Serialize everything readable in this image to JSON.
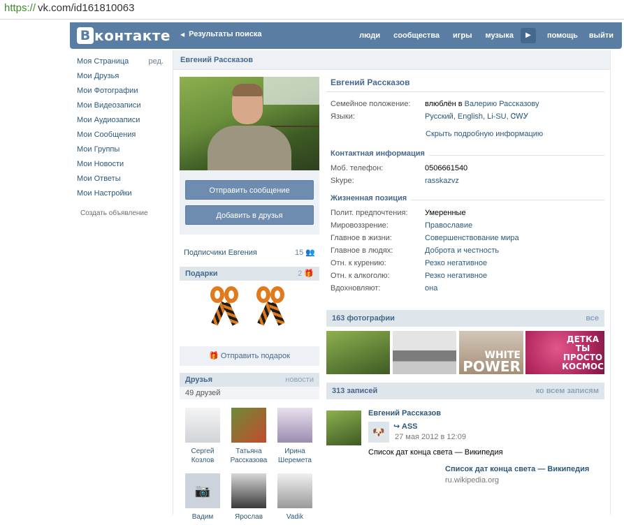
{
  "browser": {
    "url_scheme": "https://",
    "url_rest": "vk.com/id161810063"
  },
  "header": {
    "logo_letter": "В",
    "logo_text": "контакте",
    "back_link": "Результаты поиска",
    "nav": [
      "люди",
      "сообщества",
      "игры",
      "музыка"
    ],
    "nav_after": [
      "помощь",
      "выйти"
    ]
  },
  "sidebar": {
    "items": [
      "Моя Страница",
      "Мои Друзья",
      "Мои Фотографии",
      "Мои Видеозаписи",
      "Мои Аудиозаписи",
      "Мои Сообщения",
      "Мои Группы",
      "Мои Новости",
      "Мои Ответы",
      "Мои Настройки"
    ],
    "edit": "ред.",
    "ad": "Создать объявление"
  },
  "page_title": "Евгений Рассказов",
  "actions": {
    "send_message": "Отправить сообщение",
    "add_friend": "Добавить в друзья"
  },
  "subscribers": {
    "label": "Подписчики Евгения",
    "count": "15"
  },
  "gifts": {
    "title": "Подарки",
    "count": "2",
    "send": "Отправить подарок"
  },
  "friends": {
    "title": "Друзья",
    "news": "новости",
    "count": "49 друзей",
    "list": [
      {
        "first": "Сергей",
        "last": "Козлов"
      },
      {
        "first": "Татьяна",
        "last": "Рассказова"
      },
      {
        "first": "Ирина",
        "last": "Шеремета"
      },
      {
        "first": "Вадим",
        "last": ""
      },
      {
        "first": "Ярослав",
        "last": ""
      },
      {
        "first": "Vadik",
        "last": ""
      }
    ]
  },
  "profile": {
    "name": "Евгений Рассказов",
    "basic": [
      {
        "k": "Семейное положение:",
        "v_prefix": "влюблён в ",
        "v": "Валерию Рассказову"
      },
      {
        "k": "Языки:",
        "v": "Русский, English, Li-SU, ᏣᎳᎩ"
      }
    ],
    "hide_info": "Скрыть подробную информацию",
    "contact_title": "Контактная информация",
    "contact": [
      {
        "k": "Моб. телефон:",
        "v": "0506661540"
      },
      {
        "k": "Skype:",
        "v": "rasskazvz"
      }
    ],
    "life_title": "Жизненная позиция",
    "life": [
      {
        "k": "Полит. предпочтения:",
        "v": "Умеренные"
      },
      {
        "k": "Мировоззрение:",
        "v": "Православие"
      },
      {
        "k": "Главное в жизни:",
        "v": "Совершенствование мира"
      },
      {
        "k": "Главное в людях:",
        "v": "Доброта и честность"
      },
      {
        "k": "Отн. к курению:",
        "v": "Резко негативное"
      },
      {
        "k": "Отн. к алкоголю:",
        "v": "Резко негативное"
      },
      {
        "k": "Вдохновляют:",
        "v": "она"
      }
    ]
  },
  "photos": {
    "title": "163 фотографии",
    "all": "все",
    "t3_small": "WHITE",
    "t3_big": "POWER",
    "t4_text": "ДЕТКА ТЫ ПРОСТО КОСМОС"
  },
  "wall": {
    "title": "313 записей",
    "all": "ко всем записям",
    "author": "Евгений Рассказов",
    "repost_name": "ASS",
    "date": "27 мая 2012 в 12:09",
    "text": "Список дат конца света — Википедия",
    "link_title": "Список дат конца света — Википедия",
    "link_domain": "ru.wikipedia.org"
  }
}
